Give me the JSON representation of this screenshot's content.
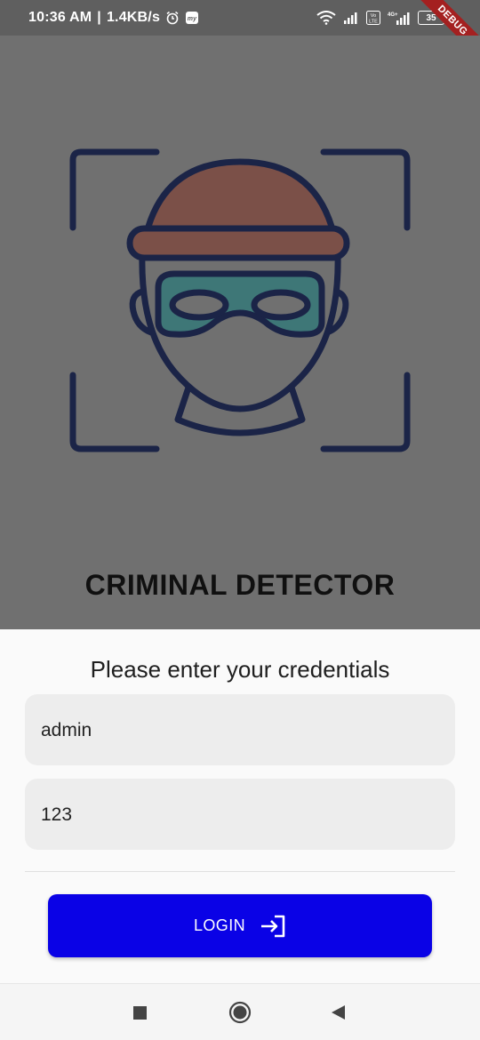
{
  "status_bar": {
    "time": "10:36 AM",
    "separator": "|",
    "speed": "1.4KB/s",
    "battery": "35",
    "icons": [
      "alarm-icon",
      "myjio-icon",
      "wifi-icon",
      "signal-icon",
      "volte-icon",
      "4g-signal-icon",
      "battery-icon"
    ]
  },
  "debug_banner": "DEBUG",
  "hero": {
    "illustration": "masked-criminal-face-scan-icon",
    "title": "CRIMINAL DETECTOR"
  },
  "form": {
    "prompt": "Please enter your credentials",
    "username_value": "admin",
    "password_value": "123",
    "login_label": "LOGIN",
    "login_icon": "login-arrow-icon"
  },
  "nav_bar": {
    "icons": [
      "recents-square-icon",
      "home-circle-icon",
      "back-triangle-icon"
    ]
  },
  "colors": {
    "hero_bg": "#707070",
    "hat": "#7b5048",
    "mask": "#3e7777",
    "outline": "#1b2447",
    "button": "#0a02e6"
  }
}
